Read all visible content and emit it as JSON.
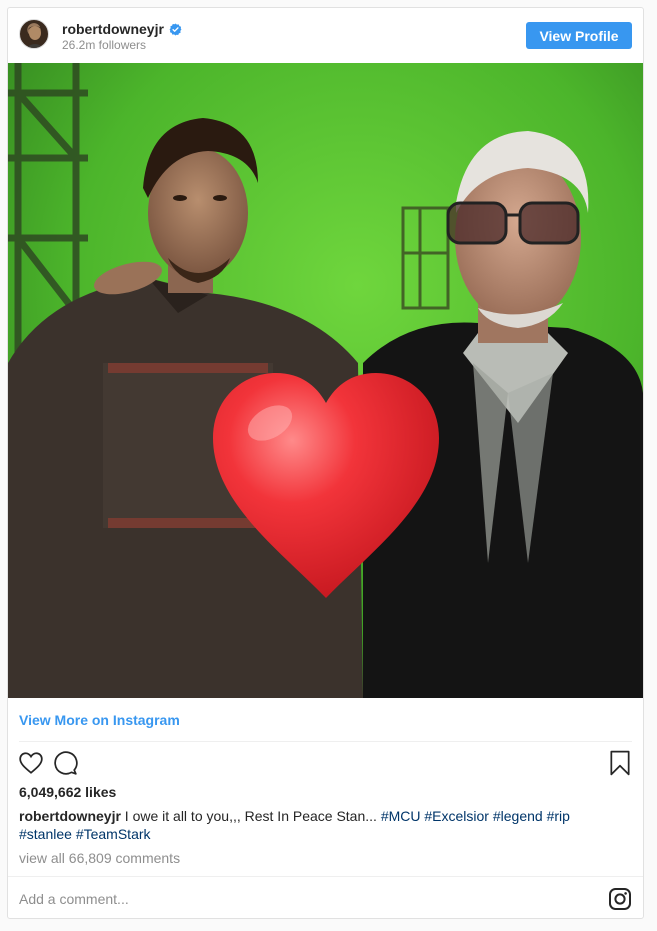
{
  "post": {
    "username": "robertdowneyjr",
    "followers": "26.2m followers",
    "view_profile_label": "View Profile",
    "view_more_label": "View More on Instagram",
    "likes": "6,049,662 likes",
    "caption_user": "robertdowneyjr",
    "caption_text": " I owe it all to you,,, Rest In Peace Stan... ",
    "hashtags": [
      "#MCU",
      "#Excelsior",
      "#legend",
      "#rip",
      "#stanlee",
      "#TeamStark"
    ],
    "comments_link": "view all 66,809 comments",
    "comment_placeholder": "Add a comment...",
    "image_subject": "Robert Downey Jr. and Stan Lee in front of a green screen with a red heart emoji"
  },
  "icons": {
    "verified": "verified-badge-icon",
    "like": "heart-outline-icon",
    "comment": "speech-bubble-icon",
    "save": "bookmark-icon",
    "instagram": "instagram-logo-icon",
    "heart_overlay": "red-heart-emoji"
  },
  "colors": {
    "accent": "#3897f0",
    "hashtag": "#003569",
    "muted": "#8e8e8e",
    "green_screen": "#48b52e",
    "heart": "#e8212b"
  }
}
